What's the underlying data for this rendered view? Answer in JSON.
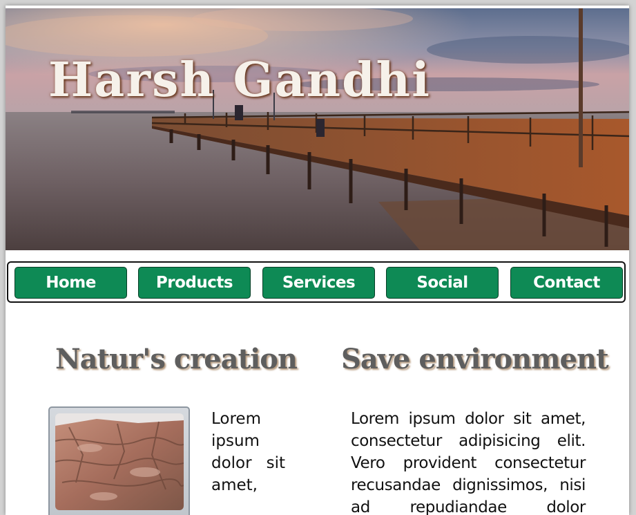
{
  "header": {
    "site_title": "Harsh Gandhi",
    "image": "pier-at-sunset"
  },
  "nav": {
    "items": [
      "Home",
      "Products",
      "Services",
      "Social",
      "Contact"
    ],
    "button_color": "#0e8a55",
    "text_color": "#ffffff"
  },
  "sections": [
    {
      "heading": "Natur's creation",
      "image": "rock-formation",
      "text_lines": [
        "Lorem",
        "ipsum",
        "dolor sit",
        "amet,"
      ]
    },
    {
      "heading": "Save environment",
      "text_lines": [
        "Lorem ipsum dolor sit amet,",
        "consectetur adipisicing elit.",
        "Vero provident consectetur",
        "recusandae dignissimos, nisi",
        "ad repudiandae dolor"
      ]
    }
  ]
}
